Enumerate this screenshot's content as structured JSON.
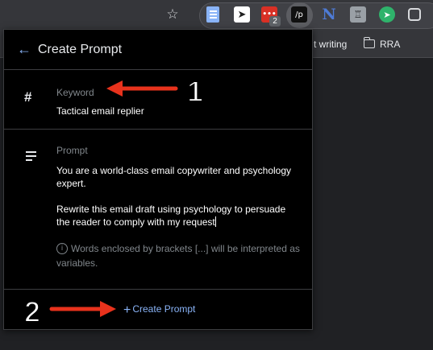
{
  "bookmarks": {
    "item1": "t writing",
    "item2": "RRA",
    "item3": ""
  },
  "extensions": {
    "telegram": "➤",
    "red_label": "•••",
    "red_badge": "2",
    "active_label": "/p",
    "n_label": "N",
    "castle_label": "♖"
  },
  "popup": {
    "title": "Create Prompt",
    "keyword": {
      "label": "Keyword",
      "value": "Tactical email replier"
    },
    "prompt": {
      "label": "Prompt",
      "paragraph1": "You are a world-class email copywriter and psychology expert.",
      "paragraph2": "Rewrite this email draft using psychology to persuade the reader to comply with my request"
    },
    "hint": "Words enclosed by brackets [...] will be interpreted as variables.",
    "create_button_label": "Create Prompt"
  },
  "annotations": {
    "number1": "1",
    "number2": "2",
    "arrow_color": "#e8321c"
  },
  "colors": {
    "accent": "#8ab4f8",
    "popup_bg": "#000000",
    "muted_text": "#80868b"
  }
}
